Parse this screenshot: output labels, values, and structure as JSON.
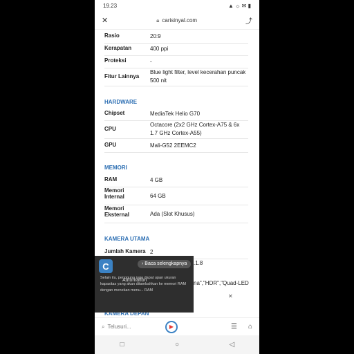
{
  "status": {
    "time": "19.23",
    "icons_right": "▲ ☼ ✉ ▮"
  },
  "urlbar": {
    "domain": "carisinyal.com",
    "close_label": "✕",
    "share_label": "⤴"
  },
  "specs_top": [
    {
      "k": "Rasio",
      "v": "20:9"
    },
    {
      "k": "Kerapatan",
      "v": "400 ppi"
    },
    {
      "k": "Proteksi",
      "v": "-"
    },
    {
      "k": "Fitur Lainnya",
      "v": "Blue light filter, level kecerahan puncak 500 nit"
    }
  ],
  "hardware": {
    "title": "HARDWARE",
    "rows": [
      {
        "k": "Chipset",
        "v": "MediaTek Helio G70"
      },
      {
        "k": "CPU",
        "v": "Octacore (2x2 GHz Cortex-A75 & 6x 1.7 GHz Cortex-A55)"
      },
      {
        "k": "GPU",
        "v": "Mali-G52 2EEMC2"
      }
    ]
  },
  "memori": {
    "title": "MEMORI",
    "rows": [
      {
        "k": "RAM",
        "v": "4 GB"
      },
      {
        "k": "Memori Internal",
        "v": "64 GB"
      },
      {
        "k": "Memori Eksternal",
        "v": "Ada (Slot Khusus)"
      }
    ]
  },
  "kamera_utama": {
    "title": "KAMERA UTAMA",
    "rows": [
      {
        "k": "Jumlah Kamera",
        "v": "2"
      }
    ],
    "partial_1": ".1.8",
    "partial_2": "na\",\"HDR\",\"Quad-LED"
  },
  "kamera_depan": {
    "title": "KAMERA DEPAN"
  },
  "overlay": {
    "logo": "C",
    "read_more": "› Baca selengkapnya",
    "automation": "Automation",
    "text": "Selain itu, pengguna juga dapat upan ukuran kapasitas yang akan ditambahkan ke memori RAM dengan menekan menu... RAM"
  },
  "close_x": "✕",
  "bottombar": {
    "search_placeholder": "Telusuri..."
  },
  "navbar": {
    "recent": "□",
    "home": "○",
    "back": "◁"
  }
}
